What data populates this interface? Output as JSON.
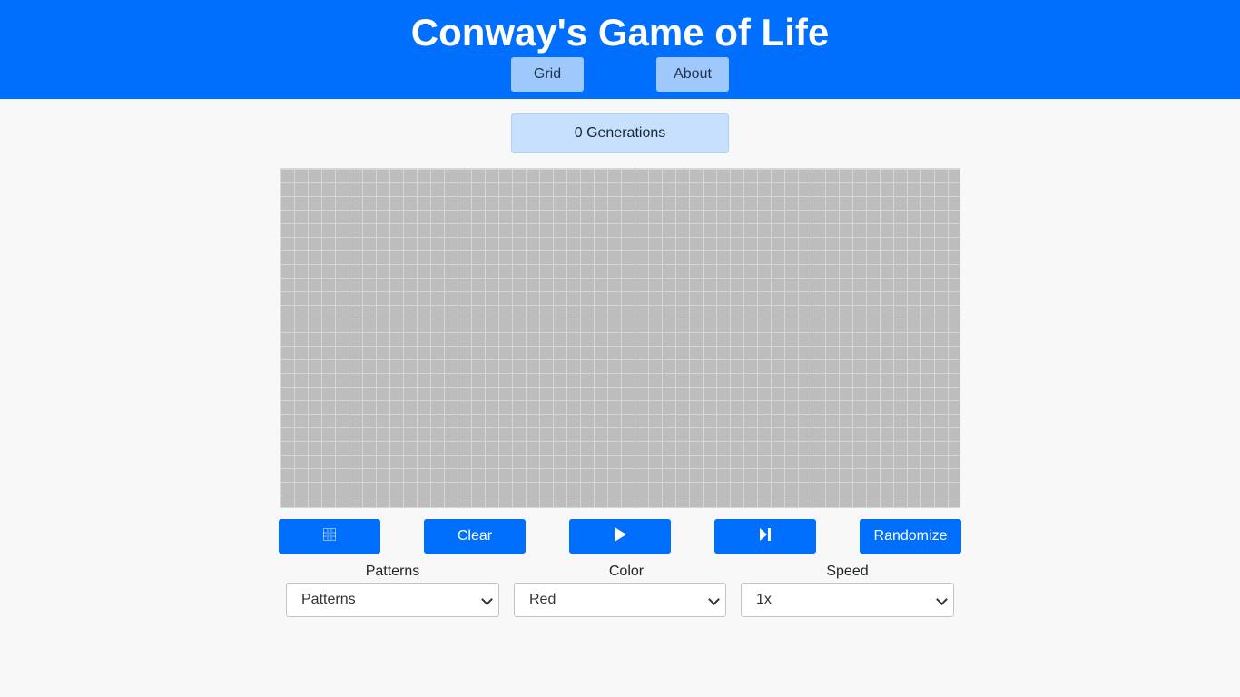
{
  "header": {
    "title": "Conway's Game of Life",
    "nav": {
      "grid_label": "Grid",
      "about_label": "About"
    }
  },
  "status": {
    "generations_text": "0 Generations"
  },
  "controls": {
    "clear_label": "Clear",
    "randomize_label": "Randomize",
    "grid_toggle_icon": "grid-icon",
    "play_icon": "play-icon",
    "step_icon": "step-forward-icon"
  },
  "options": {
    "patterns": {
      "label": "Patterns",
      "selected": "Patterns"
    },
    "color": {
      "label": "Color",
      "selected": "Red"
    },
    "speed": {
      "label": "Speed",
      "selected": "1x"
    }
  },
  "colors": {
    "primary": "#006ffd",
    "nav_button": "#9fc8fd",
    "generation_box": "#c6e0fd",
    "cell_dead": "#bdbdbd",
    "grid_line": "#d6d6d6",
    "background": "#f8f8f8"
  }
}
